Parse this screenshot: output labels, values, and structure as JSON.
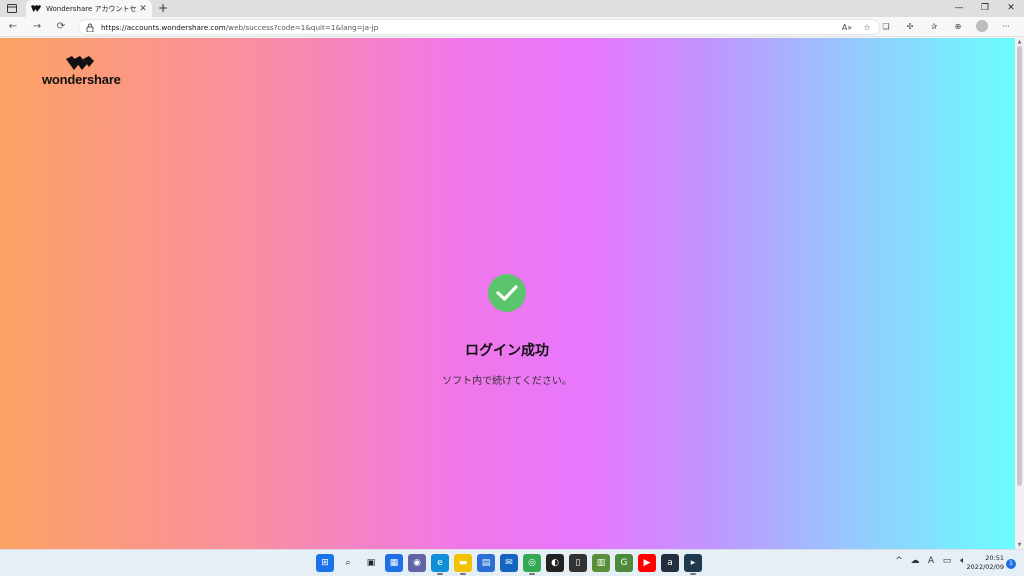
{
  "browser": {
    "tab_title": "Wondershare アカウントセンター",
    "tab_close": "✕",
    "new_tab": "+",
    "url_scheme_host": "https://accounts.wondershare.com",
    "url_path": "/web/success?code=1&quit=1&lang=ja-jp",
    "window_min": "—",
    "window_restore": "❐",
    "window_close": "✕"
  },
  "page": {
    "logo_text": "wondershare",
    "success_title": "ログイン成功",
    "success_message": "ソフト内で続けてください。"
  },
  "taskbar": {
    "apps": [
      {
        "name": "start",
        "color": "#1a73e8"
      },
      {
        "name": "search",
        "color": "#e6eef6"
      },
      {
        "name": "task-view",
        "color": "#e6eef6"
      },
      {
        "name": "widgets",
        "color": "#1f6fe6"
      },
      {
        "name": "chat",
        "color": "#6264a7"
      },
      {
        "name": "edge",
        "color": "#0f8fd8"
      },
      {
        "name": "file-explorer",
        "color": "#f2c200"
      },
      {
        "name": "store",
        "color": "#2b6fd6"
      },
      {
        "name": "mail",
        "color": "#1565c0"
      },
      {
        "name": "chrome",
        "color": "#34a853"
      },
      {
        "name": "app-dark",
        "color": "#222222"
      },
      {
        "name": "notes",
        "color": "#333333"
      },
      {
        "name": "app-green",
        "color": "#5a8f3a"
      },
      {
        "name": "app-g",
        "color": "#4b8b3b"
      },
      {
        "name": "youtube",
        "color": "#ff0000"
      },
      {
        "name": "amazon",
        "color": "#232f3e"
      },
      {
        "name": "terminal",
        "color": "#1f3a4d"
      }
    ],
    "clock_time": "20:51",
    "clock_date": "2022/02/09",
    "notification_count": "1"
  },
  "colors": {
    "success_green": "#5bc56d",
    "gradient": [
      "#fca262",
      "#f177e8",
      "#e777fe",
      "#93ccfe",
      "#6bfdfe"
    ]
  }
}
